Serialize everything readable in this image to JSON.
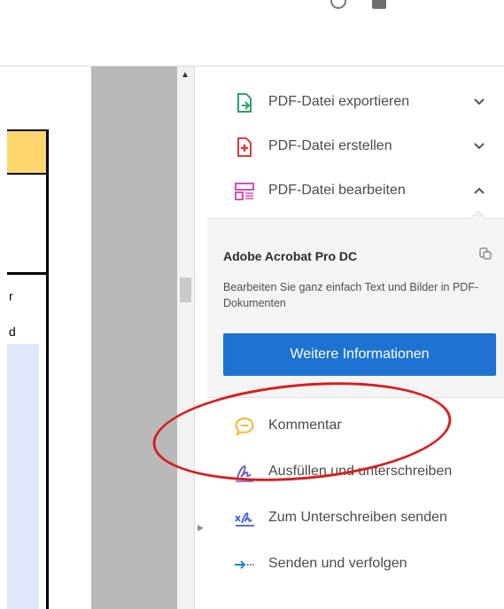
{
  "doc": {
    "cell_r": "r",
    "cell_d": "d"
  },
  "tools": [
    {
      "label": "PDF-Datei exportieren",
      "icon": "export-pdf-icon",
      "expanded": false
    },
    {
      "label": "PDF-Datei erstellen",
      "icon": "create-pdf-icon",
      "expanded": false
    },
    {
      "label": "PDF-Datei bearbeiten",
      "icon": "edit-pdf-icon",
      "expanded": true
    },
    {
      "label": "Kommentar",
      "icon": "comment-icon"
    },
    {
      "label": "Ausfüllen und unterschreiben",
      "icon": "fill-sign-icon"
    },
    {
      "label": "Zum Unterschreiben senden",
      "icon": "send-for-signature-icon"
    },
    {
      "label": "Senden und verfolgen",
      "icon": "send-track-icon"
    }
  ],
  "promo": {
    "title": "Adobe Acrobat Pro DC",
    "description": "Bearbeiten Sie ganz einfach Text und Bilder in PDF-Dokumenten",
    "button_label": "Weitere Informationen"
  },
  "colors": {
    "accent": "#1e73d2",
    "highlight_oval": "#d62020",
    "export_icon": "#2aa56a",
    "create_icon": "#e03c3c",
    "edit_icon": "#d64fb5",
    "comment_icon": "#f5b82e",
    "sign_icon": "#6e62c7"
  }
}
